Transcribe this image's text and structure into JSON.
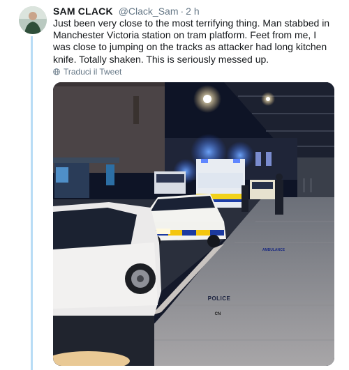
{
  "tweet": {
    "display_name": "SAM CLACK",
    "handle": "@Clack_Sam",
    "separator": "·",
    "time": "2 h",
    "text": "Just been very close to the most terrifying thing. Man stabbed in Manchester Victoria station on tram platform. Feet from me, I was close to jumping on the tracks as attacker had long kitchen knife. Totally shaken. This is seriously messed up.",
    "translate_label": "Traduci il Tweet",
    "translate_icon": "globe-icon"
  },
  "media": {
    "police_text": "POLICE",
    "ambulance_text": "AMBULANCE",
    "plate_text": "CN"
  },
  "colors": {
    "thread_line": "#b8dcf5",
    "secondary_text": "#657786",
    "primary_text": "#14171a"
  }
}
